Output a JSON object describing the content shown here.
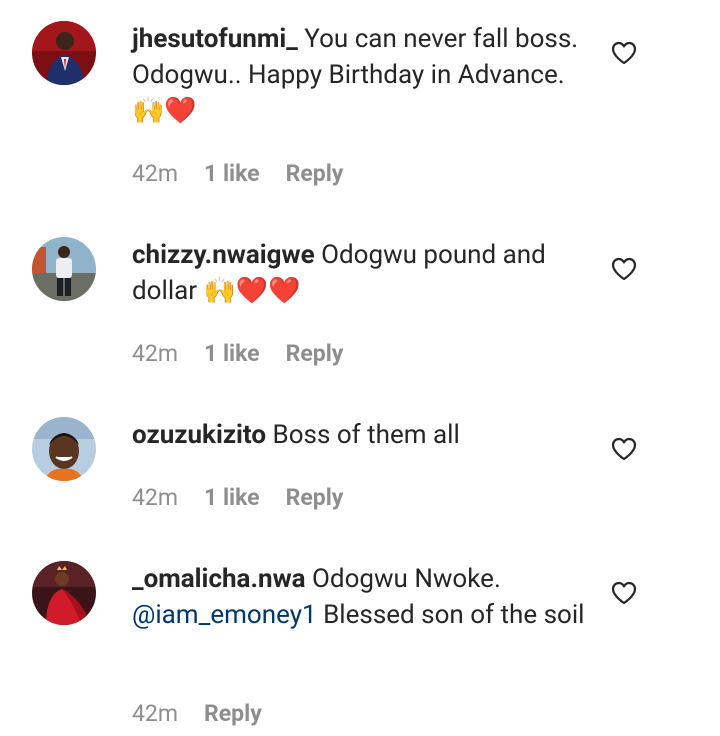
{
  "comments": [
    {
      "username": "jhesutofunmi_",
      "text_before": " You can never fall boss. Odogwu.. Happy Birthday in Advance. ",
      "emojis": "🙌❤️",
      "time": "42m",
      "likes": "1 like",
      "reply": "Reply",
      "avatar_icon": "avatar-man-red-suit"
    },
    {
      "username": "chizzy.nwaigwe",
      "text_before": " Odogwu pound and dollar ",
      "emojis": "🙌❤️❤️",
      "time": "42m",
      "likes": "1 like",
      "reply": "Reply",
      "avatar_icon": "avatar-man-standing"
    },
    {
      "username": "ozuzukizito",
      "text_before": " Boss of them all",
      "emojis": "",
      "time": "42m",
      "likes": "1 like",
      "reply": "Reply",
      "avatar_icon": "avatar-man-smiling"
    },
    {
      "username": "_omalicha.nwa",
      "text_before": " Odogwu Nwoke. ",
      "mention": "@iam_emoney1",
      "text_after": " Blessed son of the soil",
      "time": "42m",
      "reply": "Reply",
      "avatar_icon": "avatar-woman-red-dress"
    }
  ],
  "colors": {
    "text": "#262626",
    "secondary": "#8e8e8e",
    "mention": "#00376b"
  }
}
